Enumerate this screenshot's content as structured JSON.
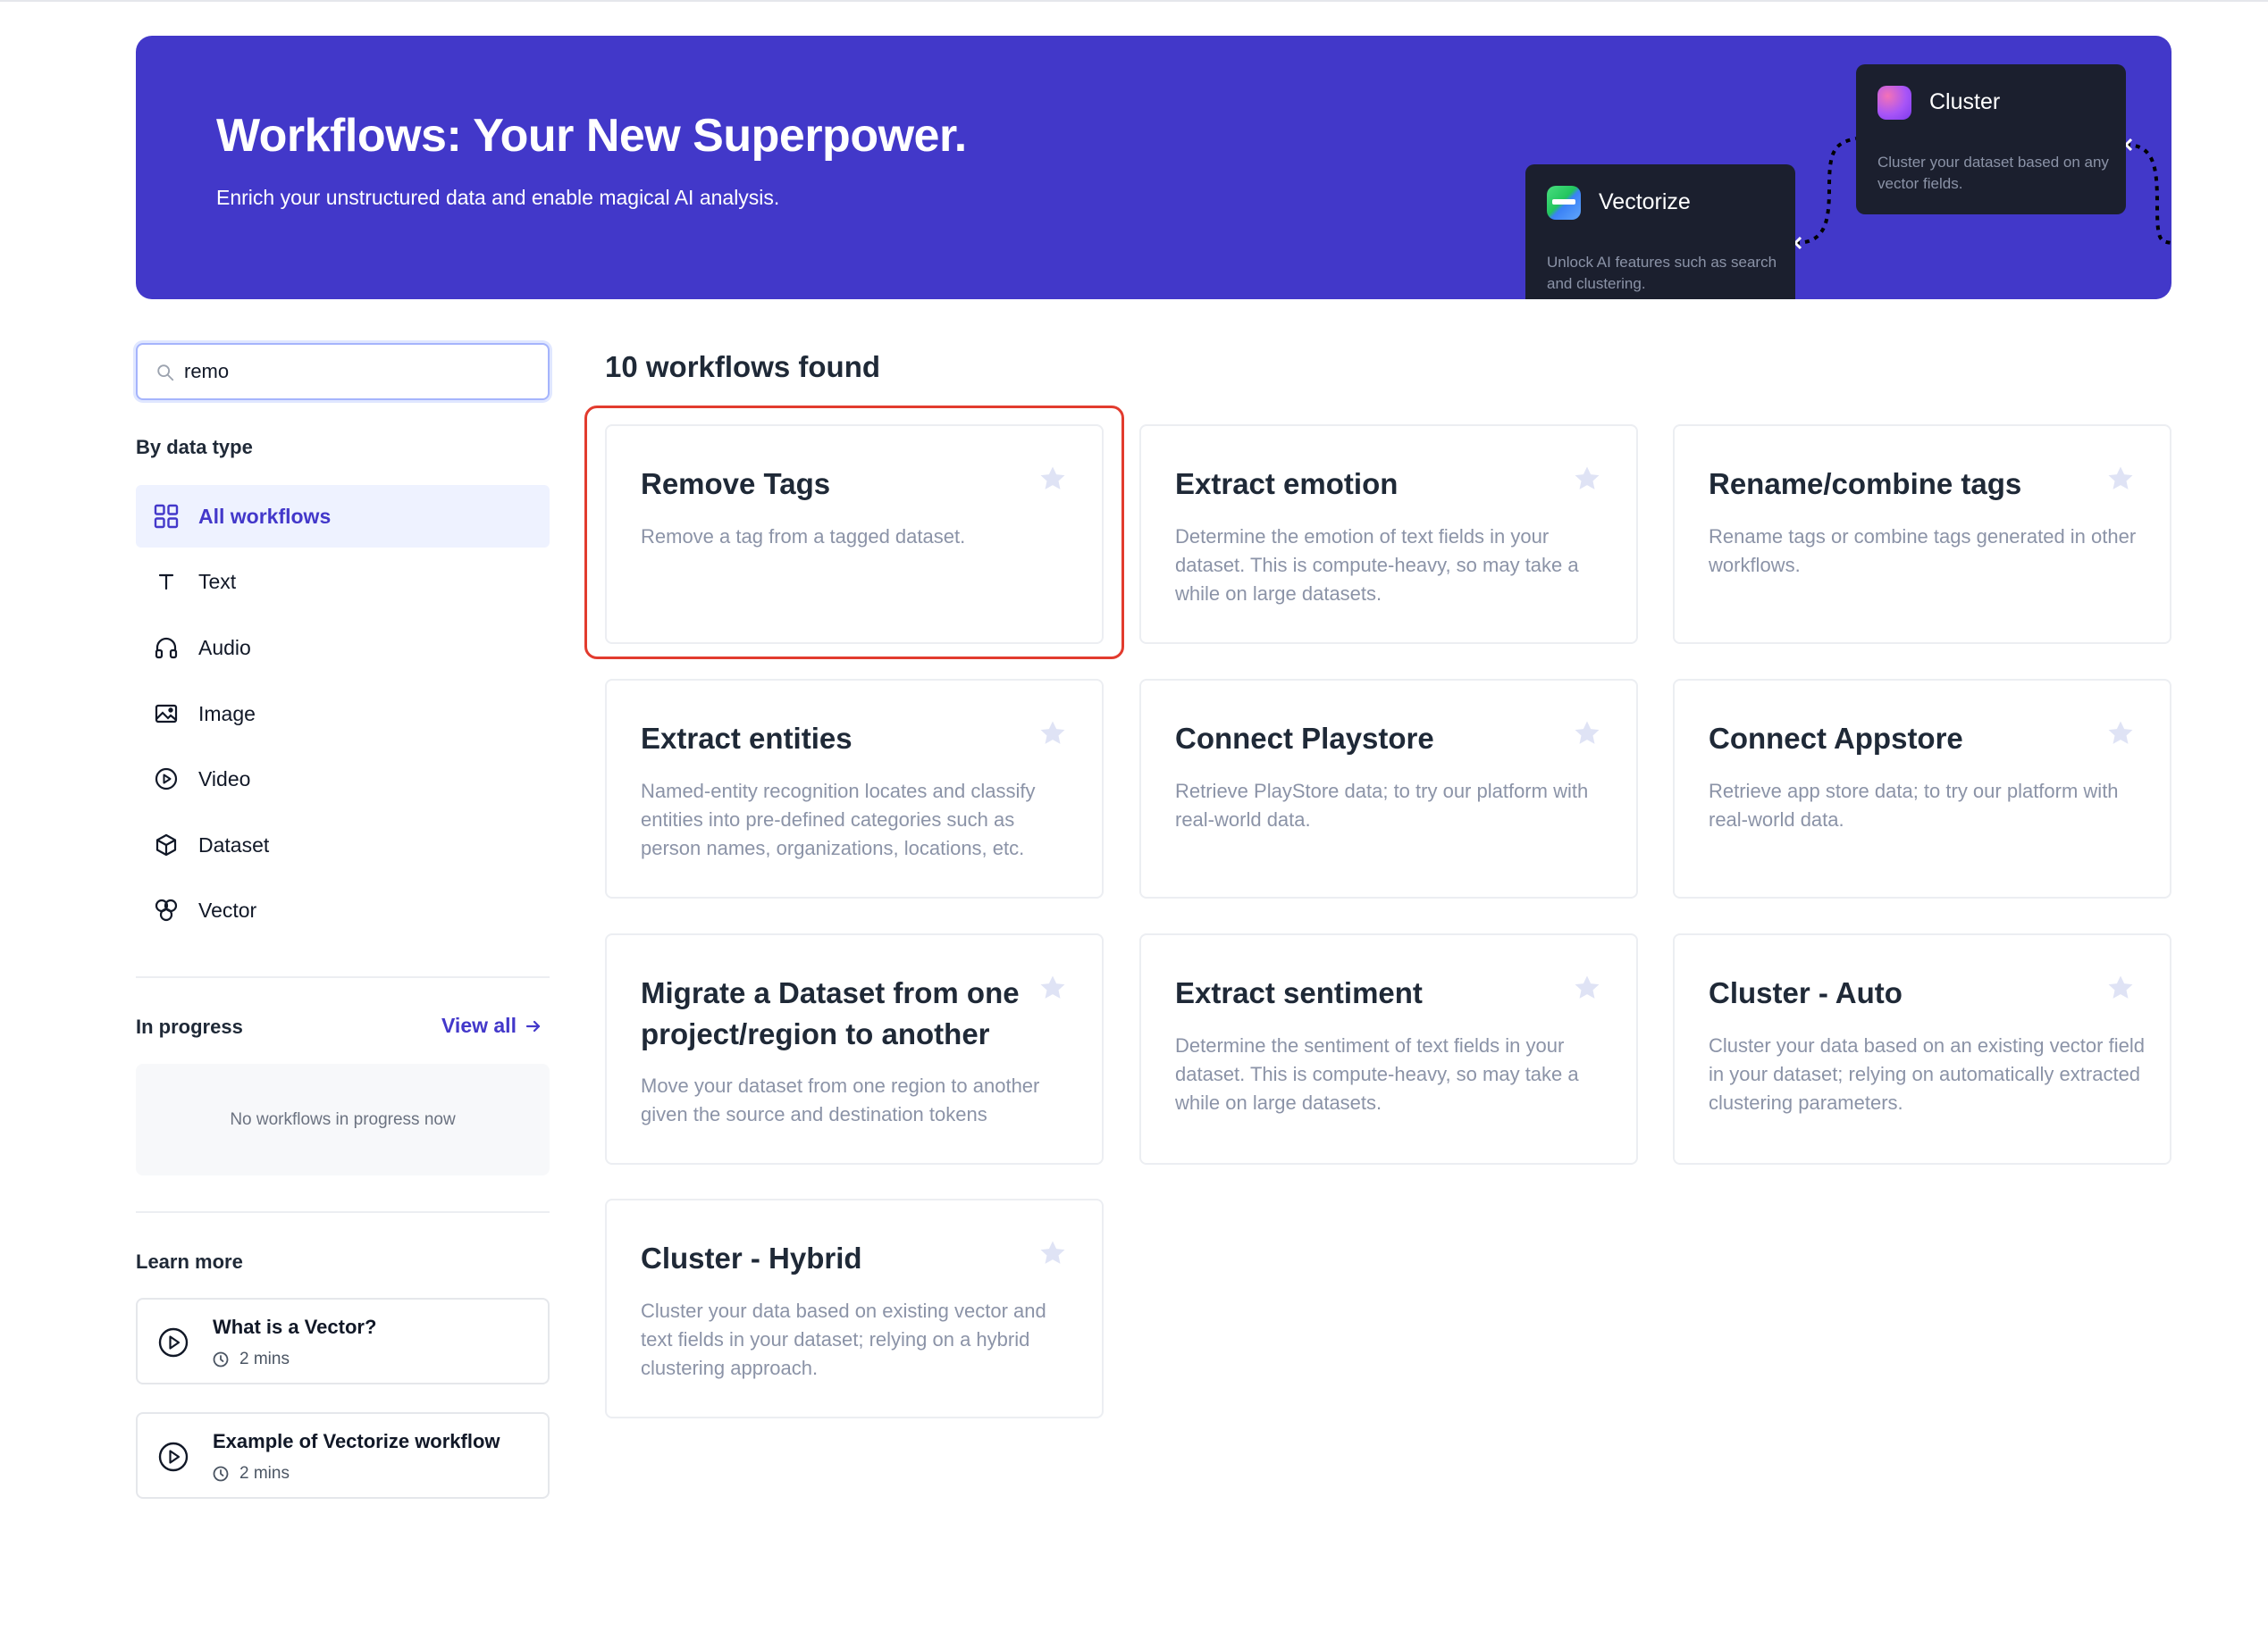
{
  "hero": {
    "title": "Workflows: Your New Superpower.",
    "subtitle": "Enrich your unstructured data and enable magical AI analysis.",
    "nodes": [
      {
        "title": "Vectorize",
        "description": "Unlock AI features such as search and clustering."
      },
      {
        "title": "Cluster",
        "description": "Cluster your dataset based on any vector fields."
      }
    ]
  },
  "search": {
    "value": "remo",
    "icon": "search-icon"
  },
  "sidebar": {
    "by_type_label": "By data type",
    "types": [
      {
        "label": "All workflows",
        "icon": "grid-icon",
        "active": true
      },
      {
        "label": "Text",
        "icon": "text-icon"
      },
      {
        "label": "Audio",
        "icon": "headphones-icon"
      },
      {
        "label": "Image",
        "icon": "image-icon"
      },
      {
        "label": "Video",
        "icon": "play-circle-icon"
      },
      {
        "label": "Dataset",
        "icon": "cube-icon"
      },
      {
        "label": "Vector",
        "icon": "vector-icon"
      }
    ],
    "in_progress_label": "In progress",
    "view_all_label": "View all",
    "empty_text": "No workflows in progress now",
    "learn_more_label": "Learn more",
    "learn_items": [
      {
        "title": "What is a Vector?",
        "duration": "2 mins"
      },
      {
        "title": "Example of Vectorize workflow",
        "duration": "2 mins"
      }
    ]
  },
  "main": {
    "found_label": "10 workflows found",
    "workflows": [
      {
        "title": "Remove Tags",
        "description": "Remove a tag from a tagged dataset."
      },
      {
        "title": "Extract emotion",
        "description": "Determine the emotion of text fields in your dataset. This is compute-heavy, so may take a while on large datasets."
      },
      {
        "title": "Rename/combine tags",
        "description": "Rename tags or combine tags generated in other workflows."
      },
      {
        "title": "Extract entities",
        "description": "Named-entity recognition locates and classify entities into pre-defined categories such as person names, organizations, locations, etc."
      },
      {
        "title": "Connect Playstore",
        "description": "Retrieve PlayStore data; to try our platform with real-world data."
      },
      {
        "title": "Connect Appstore",
        "description": "Retrieve app store data; to try our platform with real-world data."
      },
      {
        "title": "Migrate a Dataset from one project/region to another",
        "description": "Move your dataset from one region to another given the source and destination tokens"
      },
      {
        "title": "Extract sentiment",
        "description": "Determine the sentiment of text fields in your dataset. This is compute-heavy, so may take a while on large datasets."
      },
      {
        "title": "Cluster - Auto",
        "description": "Cluster your data based on an existing vector field in your dataset; relying on automatically extracted clustering parameters."
      },
      {
        "title": "Cluster - Hybrid",
        "description": "Cluster your data based on existing vector and text fields in your dataset; relying on a hybrid clustering approach."
      }
    ]
  },
  "colors": {
    "accent": "#4338ca",
    "hero_bg": "#4238c9",
    "highlight": "#e23b2e"
  }
}
